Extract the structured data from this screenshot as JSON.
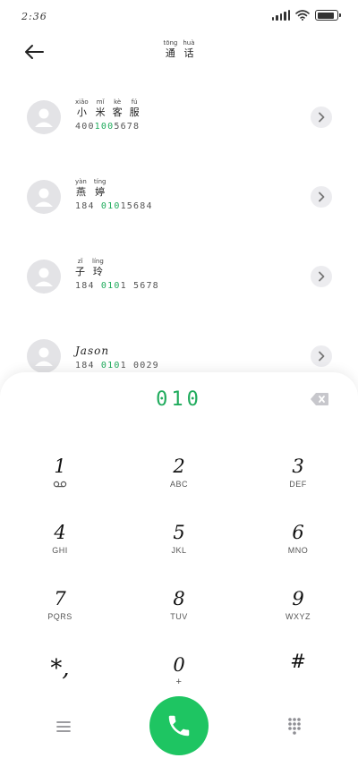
{
  "status_bar": {
    "time": "2:36",
    "signal_icon": "signal-icon",
    "wifi_icon": "wifi-icon",
    "battery_icon": "battery-icon",
    "battery_level": 0.9
  },
  "header": {
    "back_icon": "arrow-left-icon",
    "title": {
      "chars": [
        {
          "pinyin": "tōng",
          "hanzi": "通"
        },
        {
          "pinyin": "huà",
          "hanzi": "话"
        }
      ]
    }
  },
  "contacts": [
    {
      "name_ruby": [
        {
          "pinyin": "xiǎo",
          "hanzi": "小"
        },
        {
          "pinyin": "mǐ",
          "hanzi": "米"
        },
        {
          "pinyin": "kè",
          "hanzi": "客"
        },
        {
          "pinyin": "fú",
          "hanzi": "服"
        }
      ],
      "name": "",
      "number_pre": "400",
      "number_match": "100",
      "number_post": "5678"
    },
    {
      "name_ruby": [
        {
          "pinyin": "yàn",
          "hanzi": "燕"
        },
        {
          "pinyin": "tíng",
          "hanzi": "婷"
        }
      ],
      "name": "",
      "number_pre": "184 ",
      "number_match": "010",
      "number_post": "15684"
    },
    {
      "name_ruby": [
        {
          "pinyin": "zǐ",
          "hanzi": "子"
        },
        {
          "pinyin": "líng",
          "hanzi": "玲"
        }
      ],
      "name": "",
      "number_pre": "184 ",
      "number_match": "010",
      "number_post": "1 5678"
    },
    {
      "name_ruby": [],
      "name": "Jason",
      "number_pre": "184 ",
      "number_match": "010",
      "number_post": "1 0029"
    }
  ],
  "dialer": {
    "display": "010",
    "delete_icon": "backspace-icon",
    "keys": [
      {
        "digit": "1",
        "letters": "",
        "sub_icon": "voicemail-icon"
      },
      {
        "digit": "2",
        "letters": "ABC"
      },
      {
        "digit": "3",
        "letters": "DEF"
      },
      {
        "digit": "4",
        "letters": "GHI"
      },
      {
        "digit": "5",
        "letters": "JKL"
      },
      {
        "digit": "6",
        "letters": "MNO"
      },
      {
        "digit": "7",
        "letters": "PQRS"
      },
      {
        "digit": "8",
        "letters": "TUV"
      },
      {
        "digit": "9",
        "letters": "WXYZ"
      },
      {
        "digit": "*,",
        "letters": ""
      },
      {
        "digit": "0",
        "letters": "+"
      },
      {
        "digit": "#",
        "letters": ""
      }
    ],
    "menu_icon": "menu-icon",
    "call_icon": "phone-icon",
    "keypad_icon": "dialpad-icon",
    "accent_color": "#1fab5c",
    "call_color": "#1ec562"
  }
}
